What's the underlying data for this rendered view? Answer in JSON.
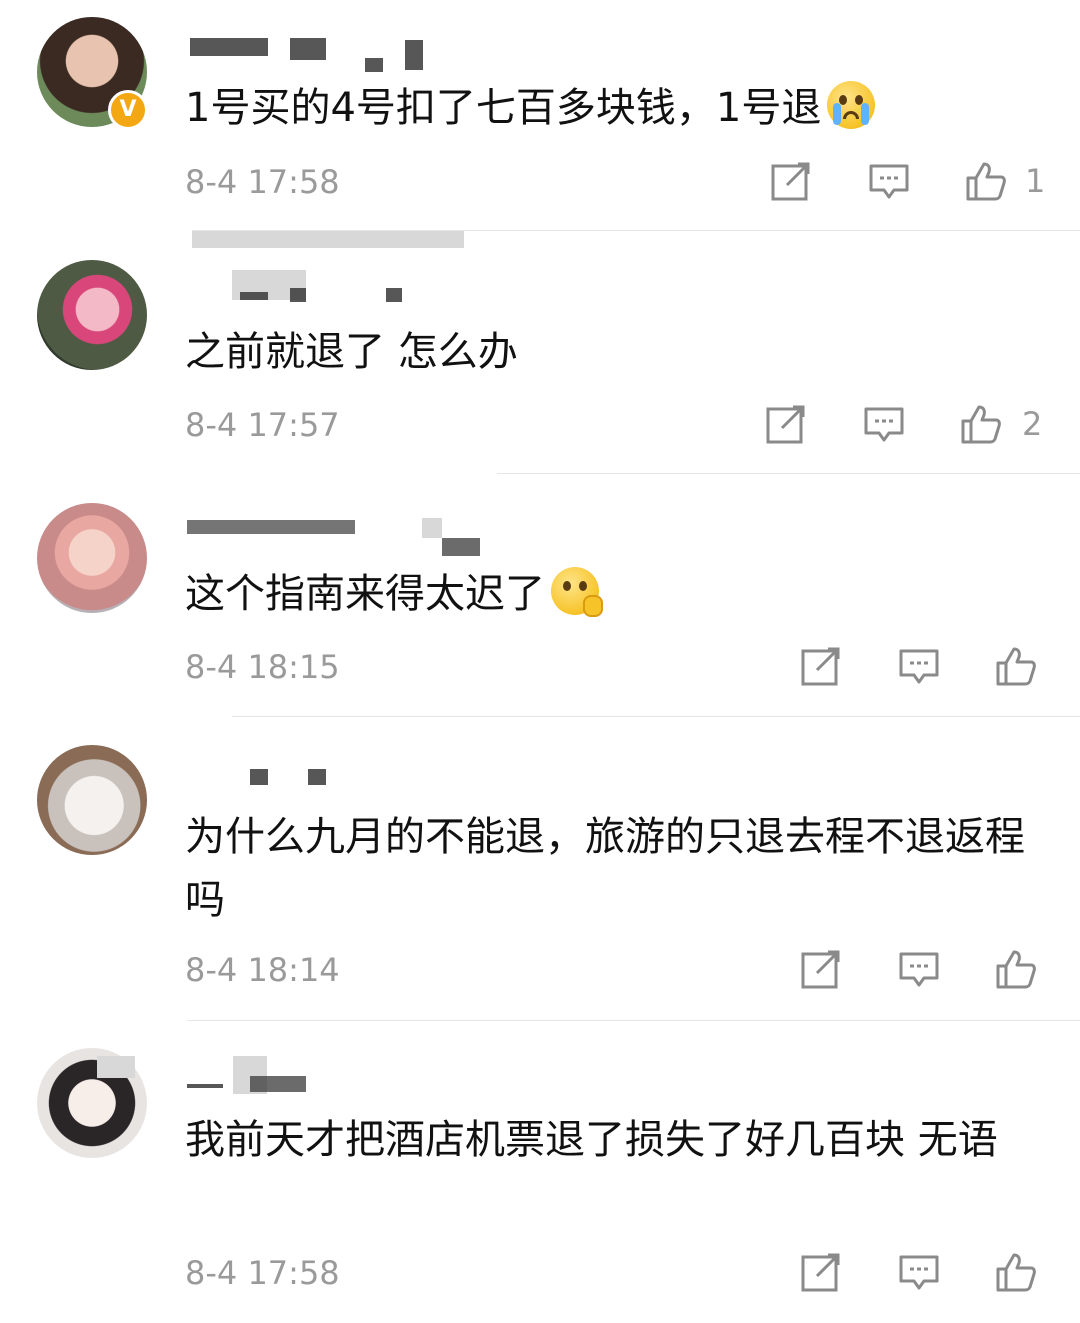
{
  "colors": {
    "verified_badge": "#f3a712",
    "timestamp": "#9a9a9a",
    "divider": "#e6e6e6"
  },
  "comments": [
    {
      "username": "",
      "verified": true,
      "text": "1号买的4号扣了七百多块钱，1号退",
      "emoji": "crying-face",
      "time": "8-4 17:58",
      "likes": "1"
    },
    {
      "username": "",
      "verified": false,
      "text": "之前就退了 怎么办",
      "emoji": "",
      "time": "8-4 17:57",
      "likes": "2"
    },
    {
      "username": "",
      "verified": false,
      "text": "这个指南来得太迟了",
      "emoji": "thinking-face",
      "time": "8-4 18:15",
      "likes": ""
    },
    {
      "username": "",
      "verified": false,
      "text": "为什么九月的不能退，旅游的只退去程不退返程吗",
      "emoji": "",
      "time": "8-4 18:14",
      "likes": ""
    },
    {
      "username": "",
      "verified": false,
      "text": "我前天才把酒店机票退了损失了好几百块 无语",
      "emoji": "",
      "time": "8-4 17:58",
      "likes": ""
    }
  ],
  "icons": {
    "share": "share-icon",
    "reply": "comment-icon",
    "like": "thumbs-up-icon"
  }
}
